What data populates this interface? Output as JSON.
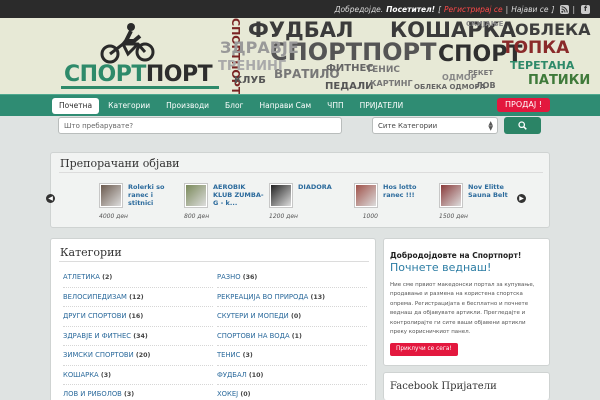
{
  "topbar": {
    "welcome": "Добредојде.",
    "guest": "Посетител!",
    "open_bracket": "[",
    "register": "Регистрирај се",
    "separator": "|",
    "login": "Најави се",
    "close_bracket": "]",
    "rss_icon": "rss-icon",
    "facebook_icon": "f"
  },
  "header": {
    "logo_part1": "СПОРТ",
    "logo_part2": "ПОРТ",
    "cloud": [
      {
        "t": "СПОРТПОРТ",
        "c": "#7a2424"
      },
      {
        "t": "ФУДБАЛ",
        "c": "#3b3b3b"
      },
      {
        "t": "КОШАРКА",
        "c": "#3a3a3a"
      },
      {
        "t": "СПОРТ",
        "c": "#2f2f2f"
      },
      {
        "t": "СПОРТПОРТ",
        "c": "#555"
      },
      {
        "t": "ОБЛЕКА",
        "c": "#3e3e3e"
      },
      {
        "t": "ТОПКА",
        "c": "#8a2a2a"
      },
      {
        "t": "ТЕРЕТАНА",
        "c": "#2e8a6a"
      },
      {
        "t": "ПАТИКИ",
        "c": "#3f7a3a"
      },
      {
        "t": "ВРАТИЛО",
        "c": "#777"
      },
      {
        "t": "ПЕДАЛИ",
        "c": "#555"
      },
      {
        "t": "ЗДРАВЈЕ",
        "c": "#999"
      },
      {
        "t": "ТРЕНИНГ",
        "c": "#aaa"
      },
      {
        "t": "КЛУБ",
        "c": "#555"
      },
      {
        "t": "СКИЈАЊЕ",
        "c": "#888"
      },
      {
        "t": "ЛОВ",
        "c": "#666"
      },
      {
        "t": "ОДМОР",
        "c": "#888"
      },
      {
        "t": "ТЕНИС",
        "c": "#777"
      },
      {
        "t": "ФИТНЕС",
        "c": "#666"
      },
      {
        "t": "КАРТИНГ",
        "c": "#777"
      },
      {
        "t": "ОБЛЕКА ОДМОРА",
        "c": "#666"
      },
      {
        "t": "РЕКЕТ",
        "c": "#777"
      }
    ]
  },
  "nav": {
    "items": [
      "Почетна",
      "Категории",
      "Производи",
      "Блог",
      "Направи Сам",
      "ЧПП",
      "ПРИЈАТЕЛИ"
    ],
    "active": 0,
    "sell_button": "ПРОДАЈ !"
  },
  "search": {
    "placeholder": "Што пребарувате?",
    "category_value": "Сите Категории"
  },
  "featured": {
    "title": "Препорачани објави",
    "items": [
      {
        "title": "Rolerki so ranec i stitnici",
        "price": "4000 ден",
        "color": "#6b5a4e"
      },
      {
        "title": "AEROBIK KLUB ZUMBA-G - k...",
        "price": "800 ден",
        "color": "#7a8a5a"
      },
      {
        "title": "DIADORA",
        "price": "1200 ден",
        "color": "#222"
      },
      {
        "title": "Hos lotto ranec !!!",
        "price": "1000",
        "color": "#a0524a"
      },
      {
        "title": "Nov Elitte Sauna Belt",
        "price": "1500 ден",
        "color": "#8a3a3a"
      }
    ]
  },
  "categories": {
    "title": "Категории",
    "left": [
      {
        "name": "АТЛЕТИКА",
        "count": "(2)"
      },
      {
        "name": "ВЕЛОСИПЕДИЗАМ",
        "count": "(12)"
      },
      {
        "name": "ДРУГИ СПОРТОВИ",
        "count": "(16)"
      },
      {
        "name": "ЗДРАВЈЕ И ФИТНЕС",
        "count": "(34)"
      },
      {
        "name": "ЗИМСКИ СПОРТОВИ",
        "count": "(20)"
      },
      {
        "name": "КОШАРКА",
        "count": "(3)"
      },
      {
        "name": "ЛОВ И РИБОЛОВ",
        "count": "(3)"
      }
    ],
    "right": [
      {
        "name": "РАЗНО",
        "count": "(36)"
      },
      {
        "name": "РЕКРЕАЦИЈА ВО ПРИРОДА",
        "count": "(13)"
      },
      {
        "name": "СКУТЕРИ И МОПЕДИ",
        "count": "(0)"
      },
      {
        "name": "СПОРТОВИ НА ВОДА",
        "count": "(1)"
      },
      {
        "name": "ТЕНИС",
        "count": "(3)"
      },
      {
        "name": "ФУДБАЛ",
        "count": "(10)"
      },
      {
        "name": "ХОКЕЈ",
        "count": "(0)"
      }
    ]
  },
  "welcome": {
    "heading": "Добродојдовте на Спортпорт!",
    "subheading": "Почнете веднаш!",
    "text": "Ние сме првиот македонски портал за купување, продавање и размена на користена спортска опрема. Регистрацијата е бесплатно и почнете веднаш да објавувате артикли. Прегледајте и контролирајте ги сите ваши објавени артикли преку корисничкиот панел.",
    "button": "Приклучи се сега!"
  },
  "facebook": {
    "title": "Facebook Пријатели"
  },
  "colors": {
    "accent": "#2f8c73",
    "sell": "#e3183e",
    "link": "#2b6a9c"
  }
}
